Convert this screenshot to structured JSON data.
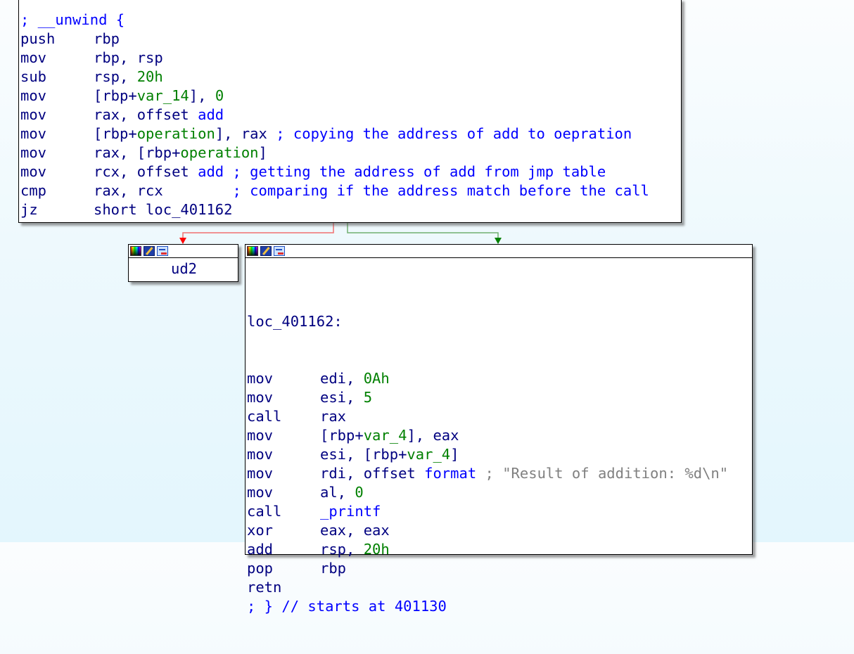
{
  "top_block": {
    "lines": [
      {
        "type": "comment",
        "text": "; __unwind {"
      },
      {
        "mnemonic": "push",
        "parts": [
          {
            "t": "rbp",
            "c": "ops"
          }
        ]
      },
      {
        "mnemonic": "mov",
        "parts": [
          {
            "t": "rbp, rsp",
            "c": "ops"
          }
        ]
      },
      {
        "mnemonic": "sub",
        "parts": [
          {
            "t": "rsp, ",
            "c": "ops"
          },
          {
            "t": "20h",
            "c": "num"
          }
        ]
      },
      {
        "mnemonic": "mov",
        "parts": [
          {
            "t": "[rbp+",
            "c": "ops"
          },
          {
            "t": "var_14",
            "c": "var"
          },
          {
            "t": "], ",
            "c": "ops"
          },
          {
            "t": "0",
            "c": "num"
          }
        ]
      },
      {
        "mnemonic": "mov",
        "parts": [
          {
            "t": "rax, offset ",
            "c": "ops"
          },
          {
            "t": "add",
            "c": "sym"
          }
        ]
      },
      {
        "mnemonic": "mov",
        "parts": [
          {
            "t": "[rbp+",
            "c": "ops"
          },
          {
            "t": "operation",
            "c": "var"
          },
          {
            "t": "], rax ",
            "c": "ops"
          },
          {
            "t": "; copying the address of add to oepration",
            "c": "cm"
          }
        ]
      },
      {
        "mnemonic": "mov",
        "parts": [
          {
            "t": "rax, [rbp+",
            "c": "ops"
          },
          {
            "t": "operation",
            "c": "var"
          },
          {
            "t": "]",
            "c": "ops"
          }
        ]
      },
      {
        "mnemonic": "mov",
        "parts": [
          {
            "t": "rcx, offset ",
            "c": "ops"
          },
          {
            "t": "add",
            "c": "sym"
          },
          {
            "t": " ",
            "c": "ops"
          },
          {
            "t": "; getting the address of add from jmp table",
            "c": "cm"
          }
        ]
      },
      {
        "mnemonic": "cmp",
        "parts": [
          {
            "t": "rax, rcx        ",
            "c": "ops"
          },
          {
            "t": "; comparing if the address match before the call",
            "c": "cm"
          }
        ]
      },
      {
        "mnemonic": "jz",
        "parts": [
          {
            "t": "short loc_401162",
            "c": "ops"
          }
        ]
      }
    ]
  },
  "fail_block": {
    "header_icons": [
      "color-palette-icon",
      "edit-pencil-icon",
      "graph-view-icon"
    ],
    "instruction": "ud2"
  },
  "success_block": {
    "header_icons": [
      "color-palette-icon",
      "edit-pencil-icon",
      "graph-view-icon"
    ],
    "label": "loc_401162:",
    "lines": [
      {
        "mnemonic": "mov",
        "parts": [
          {
            "t": "edi, ",
            "c": "ops"
          },
          {
            "t": "0Ah",
            "c": "num"
          }
        ]
      },
      {
        "mnemonic": "mov",
        "parts": [
          {
            "t": "esi, ",
            "c": "ops"
          },
          {
            "t": "5",
            "c": "num"
          }
        ]
      },
      {
        "mnemonic": "call",
        "parts": [
          {
            "t": "rax",
            "c": "ops"
          }
        ]
      },
      {
        "mnemonic": "mov",
        "parts": [
          {
            "t": "[rbp+",
            "c": "ops"
          },
          {
            "t": "var_4",
            "c": "var"
          },
          {
            "t": "], eax",
            "c": "ops"
          }
        ]
      },
      {
        "mnemonic": "mov",
        "parts": [
          {
            "t": "esi, [rbp+",
            "c": "ops"
          },
          {
            "t": "var_4",
            "c": "var"
          },
          {
            "t": "]",
            "c": "ops"
          }
        ]
      },
      {
        "mnemonic": "mov",
        "parts": [
          {
            "t": "rdi, offset ",
            "c": "ops"
          },
          {
            "t": "format",
            "c": "sym"
          },
          {
            "t": " ; \"Result of addition: %d\\n\"",
            "c": "str"
          }
        ]
      },
      {
        "mnemonic": "mov",
        "parts": [
          {
            "t": "al, ",
            "c": "ops"
          },
          {
            "t": "0",
            "c": "num"
          }
        ]
      },
      {
        "mnemonic": "call",
        "parts": [
          {
            "t": "_printf",
            "c": "sym"
          }
        ]
      },
      {
        "mnemonic": "xor",
        "parts": [
          {
            "t": "eax, eax",
            "c": "ops"
          }
        ]
      },
      {
        "mnemonic": "add",
        "parts": [
          {
            "t": "rsp, ",
            "c": "ops"
          },
          {
            "t": "20h",
            "c": "num"
          }
        ]
      },
      {
        "mnemonic": "pop",
        "parts": [
          {
            "t": "rbp",
            "c": "ops"
          }
        ]
      },
      {
        "mnemonic": "retn",
        "parts": []
      },
      {
        "type": "comment",
        "text": "; } // starts at 401130"
      }
    ]
  },
  "edges": [
    {
      "from": "top_block",
      "to": "fail_block",
      "kind": "false-branch",
      "color": "#ff0000"
    },
    {
      "from": "top_block",
      "to": "success_block",
      "kind": "true-branch",
      "color": "#008000"
    }
  ],
  "colors": {
    "mnemonic": "#000080",
    "comment": "#0000ff",
    "number": "#008000",
    "string_comment": "#808080",
    "false_edge": "#ff0000",
    "true_edge": "#008000"
  }
}
